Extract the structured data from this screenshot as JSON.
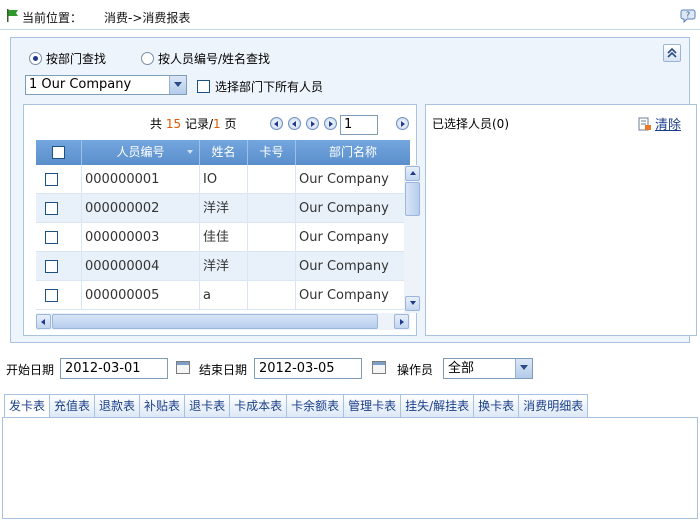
{
  "breadcrumb": {
    "label": "当前位置：",
    "path": "消费->消费报表"
  },
  "search_mode": {
    "by_dept_label": "按部门查找",
    "by_person_label": "按人员编号/姓名查找",
    "selected": "by_dept"
  },
  "department": {
    "selected": "1 Our Company",
    "include_sub_label": "选择部门下所有人员"
  },
  "pager": {
    "prefix": "共",
    "records": "15",
    "records_suffix": "记录/",
    "pages": "1",
    "pages_suffix": "页",
    "current_page": "1"
  },
  "grid": {
    "columns": [
      "人员编号",
      "姓名",
      "卡号",
      "部门名称"
    ],
    "rows": [
      {
        "id": "000000001",
        "name": "IO",
        "card": "",
        "dept": "Our Company"
      },
      {
        "id": "000000002",
        "name": "洋洋",
        "card": "",
        "dept": "Our Company"
      },
      {
        "id": "000000003",
        "name": "佳佳",
        "card": "",
        "dept": "Our Company"
      },
      {
        "id": "000000004",
        "name": "洋洋",
        "card": "",
        "dept": "Our Company"
      },
      {
        "id": "000000005",
        "name": "a",
        "card": "",
        "dept": "Our Company"
      }
    ]
  },
  "selected_panel": {
    "title": "已选择人员(0)",
    "clear_label": "清除"
  },
  "filters": {
    "start_label": "开始日期",
    "start_value": "2012-03-01",
    "end_label": "结束日期",
    "end_value": "2012-03-05",
    "operator_label": "操作员",
    "operator_value": "全部"
  },
  "tabs": [
    "发卡表",
    "充值表",
    "退款表",
    "补贴表",
    "退卡表",
    "卡成本表",
    "卡余额表",
    "管理卡表",
    "挂失/解挂表",
    "换卡表",
    "消费明细表"
  ],
  "colors": {
    "header_blue": "#5b8fcc",
    "accent_orange": "#e05a00",
    "flag_green": "#2e9a2e"
  }
}
